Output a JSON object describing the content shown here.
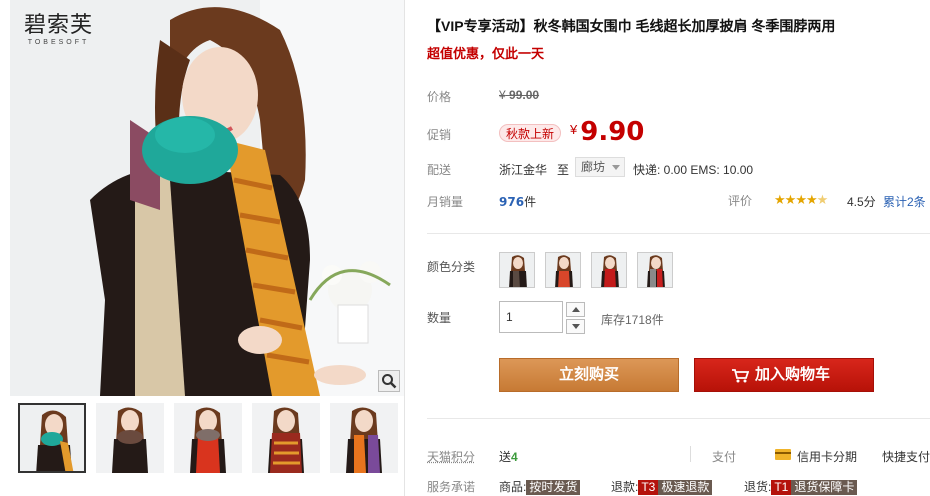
{
  "brand": {
    "logo_cn": "碧索芙",
    "logo_en": "TOBESOFT"
  },
  "product": {
    "title": "【VIP专享活动】秋冬韩国女围巾 毛线超长加厚披肩 冬季围脖两用",
    "subtitle": "超值优惠，仅此一天"
  },
  "price": {
    "label": "价格",
    "currency": "¥",
    "original": "99.00",
    "promo_label": "促销",
    "promo_tag": "秋款上新",
    "promo": "9.90"
  },
  "shipping": {
    "label": "配送",
    "from": "浙江金华",
    "to_label": "至",
    "city": "廊坊",
    "fee": "快递: 0.00 EMS: 10.00"
  },
  "sales": {
    "label": "月销量",
    "count": "976",
    "unit": "件",
    "rating_label": "评价",
    "stars": 4.5,
    "score": "4.5分",
    "review_count": "累计2条"
  },
  "options": {
    "color_label": "颜色分类",
    "swatches": [
      "dark-scarf",
      "red-orange-scarf",
      "red-scarf",
      "grey-red-scarf"
    ]
  },
  "quantity": {
    "label": "数量",
    "value": "1",
    "stock": "库存1718件"
  },
  "actions": {
    "buy_now": "立刻购买",
    "add_to_cart": "加入购物车"
  },
  "services": {
    "points_label": "天猫积分",
    "points_prefix": "送",
    "points_value": "4",
    "pay_label": "支付",
    "installment": "信用卡分期",
    "quick_pay": "快捷支付",
    "promise_label": "服务承诺",
    "goods_label": "商品:",
    "goods_tag": "按时发货",
    "refund_label": "退款:",
    "refund_code": "T3",
    "refund_tag": "极速退款",
    "return_label": "退货:",
    "return_code": "T1",
    "return_tag": "退货保障卡"
  },
  "colors": {
    "accent_red": "#c40000",
    "buy_orange": "#d38a44",
    "cart_red": "#c81a10",
    "link_blue": "#2b62b4",
    "scarf_teal": "#1fa89a",
    "scarf_orange": "#e39a2c"
  }
}
